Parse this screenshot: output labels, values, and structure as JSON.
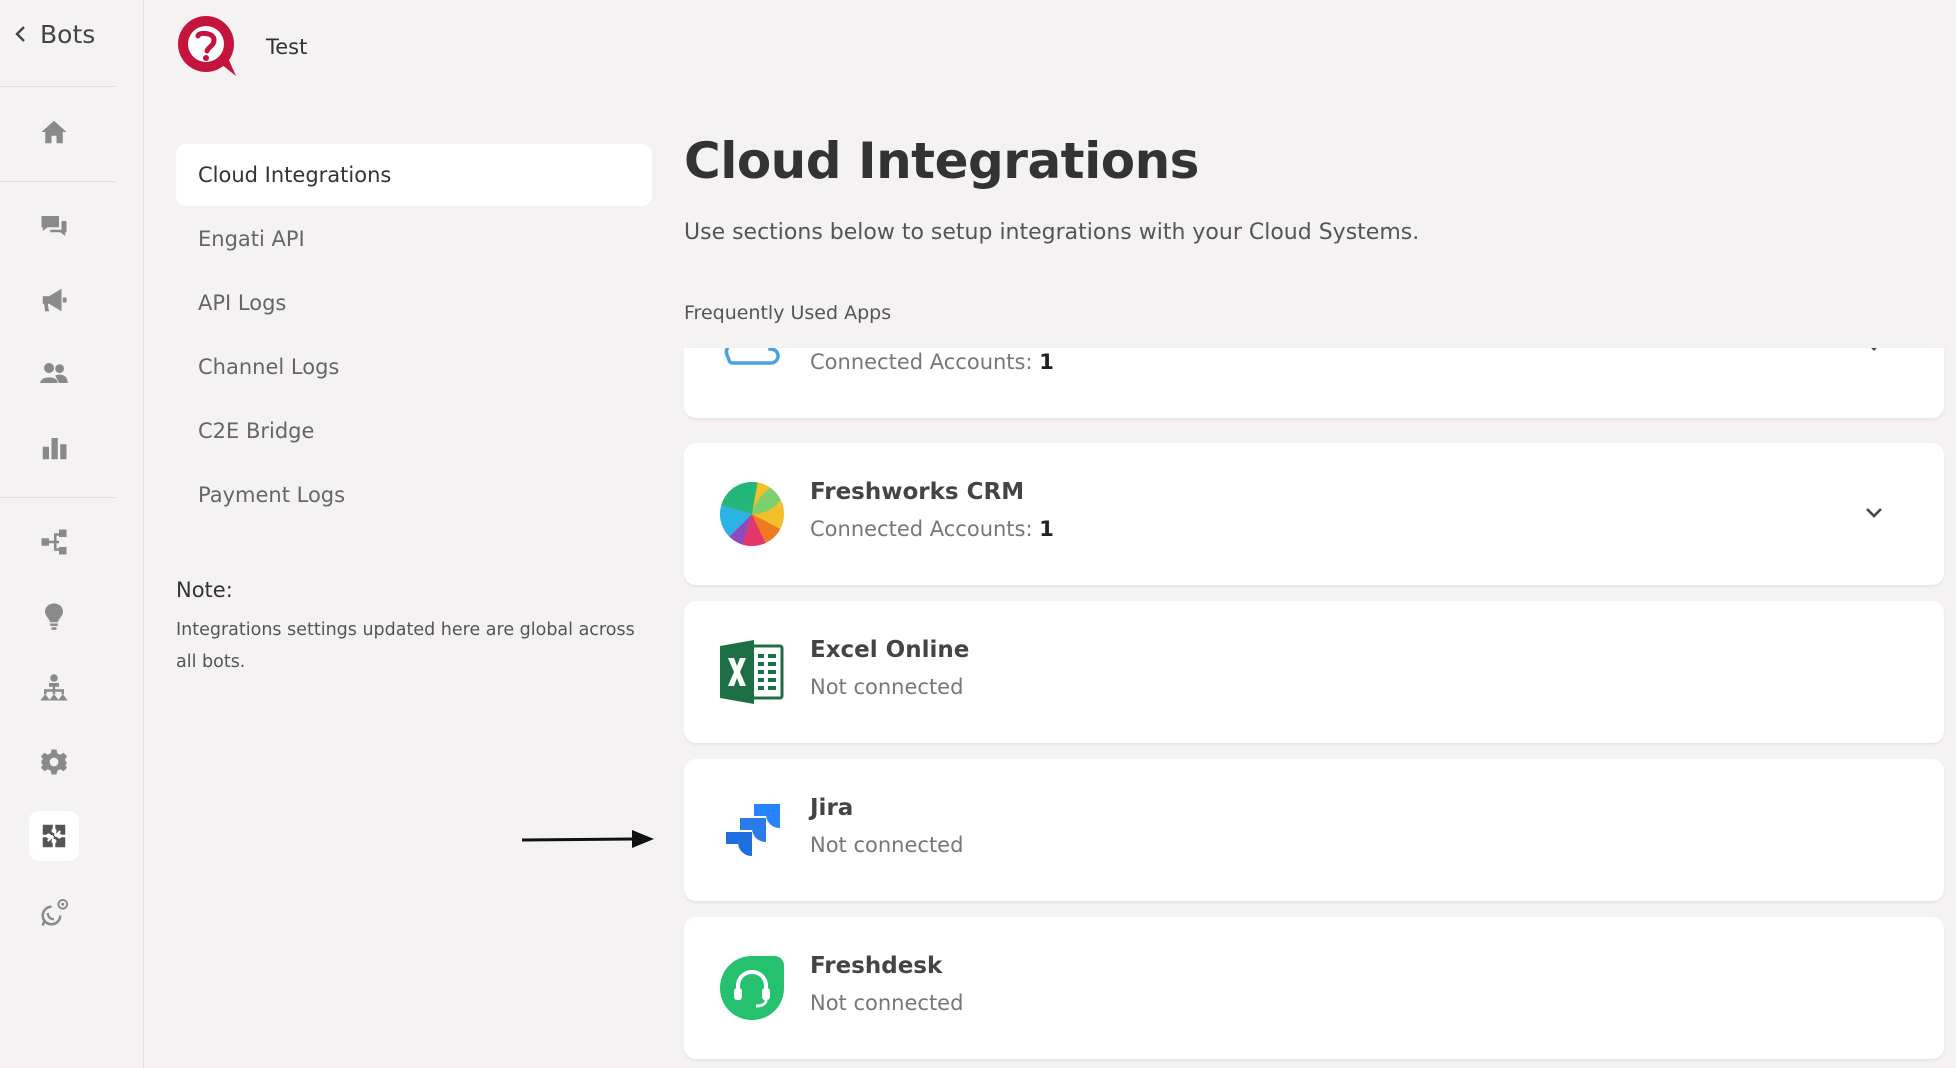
{
  "rail": {
    "back_label": "Bots",
    "icons": [
      "home-icon",
      "chat-icon",
      "megaphone-icon",
      "users-icon",
      "bar-chart-icon",
      "flow-icon",
      "lightbulb-icon",
      "org-chart-icon",
      "gear-icon",
      "integrations-puzzle-icon",
      "whatsapp-settings-icon"
    ],
    "active_icon": "integrations-puzzle-icon"
  },
  "brand": {
    "name": "Test",
    "logo_color": "#c4143c"
  },
  "subnav": {
    "items": [
      {
        "label": "Cloud Integrations",
        "active": true
      },
      {
        "label": "Engati API"
      },
      {
        "label": "API Logs"
      },
      {
        "label": "Channel Logs"
      },
      {
        "label": "C2E Bridge"
      },
      {
        "label": "Payment Logs"
      }
    ]
  },
  "note": {
    "title": "Note:",
    "text": "Integrations settings updated here are global across all bots."
  },
  "main": {
    "title": "Cloud Integrations",
    "description": "Use sections below to setup integrations with your Cloud Systems.",
    "section_label": "Frequently Used Apps"
  },
  "apps": [
    {
      "name": "",
      "status_label": "Connected Accounts: ",
      "status_count": "1",
      "icon": "cloud-icon",
      "expandable": true
    },
    {
      "name": "Freshworks CRM",
      "status_label": "Connected Accounts: ",
      "status_count": "1",
      "icon": "freshworks-crm-icon",
      "expandable": true
    },
    {
      "name": "Excel Online",
      "status_label": "Not connected",
      "status_count": "",
      "icon": "excel-icon",
      "expandable": false
    },
    {
      "name": "Jira",
      "status_label": "Not connected",
      "status_count": "",
      "icon": "jira-icon",
      "expandable": false
    },
    {
      "name": "Freshdesk",
      "status_label": "Not connected",
      "status_count": "",
      "icon": "freshdesk-icon",
      "expandable": false
    }
  ],
  "colors": {
    "background": "#f4f2f3",
    "card": "#ffffff",
    "excel_green": "#1d7044",
    "jira_blue": "#2684ff",
    "freshdesk_green": "#25c16f",
    "cloud_blue": "#4aa3df"
  }
}
